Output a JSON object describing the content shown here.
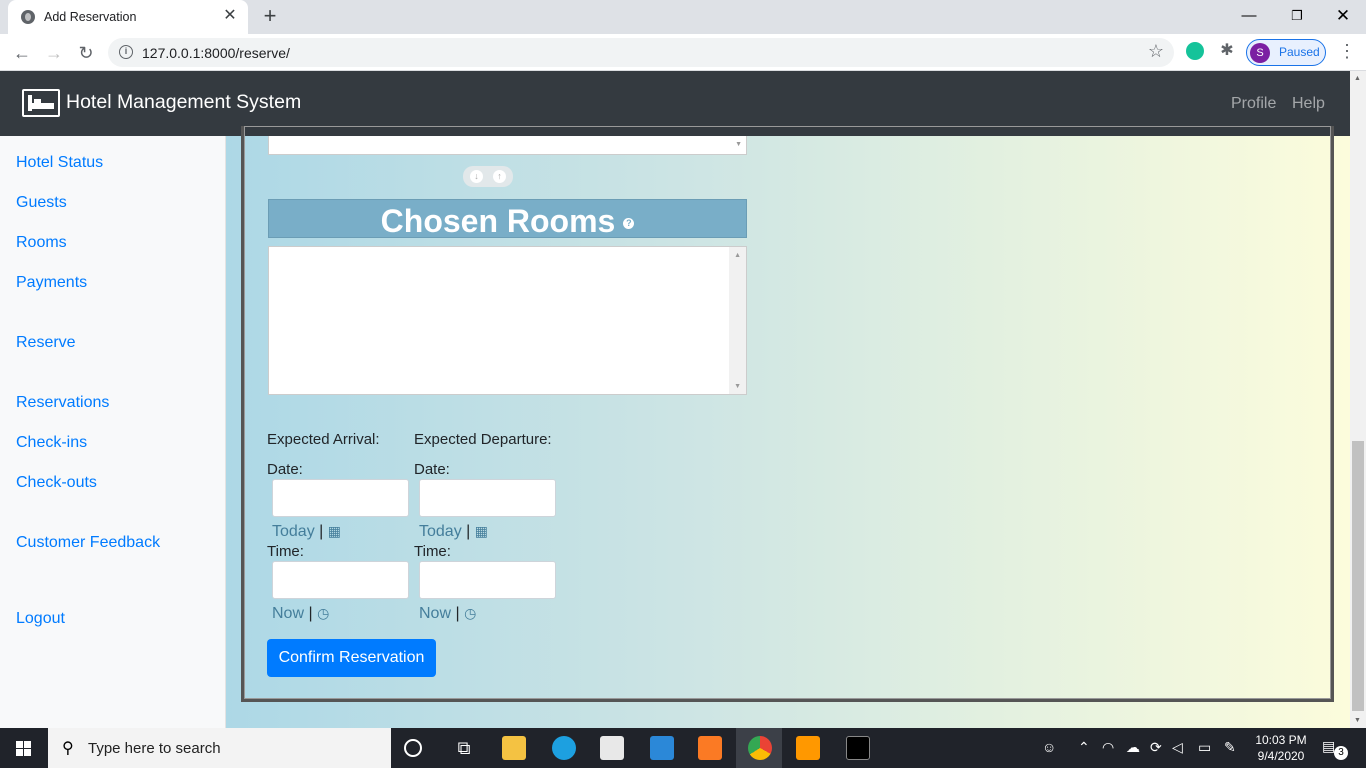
{
  "browser": {
    "tab_title": "Add Reservation",
    "url": "127.0.0.1:8000/reserve/",
    "profile_letter": "S",
    "profile_status": "Paused"
  },
  "app": {
    "brand": "Hotel Management System",
    "nav": [
      "Profile",
      "Help"
    ]
  },
  "sidebar": {
    "items": [
      {
        "label": "Hotel Status"
      },
      {
        "label": "Guests"
      },
      {
        "label": "Rooms"
      },
      {
        "label": "Payments"
      },
      {
        "label": "Reserve"
      },
      {
        "label": "Reservations"
      },
      {
        "label": "Check-ins"
      },
      {
        "label": "Check-outs"
      },
      {
        "label": "Customer Feedback"
      },
      {
        "label": "Logout"
      }
    ]
  },
  "form": {
    "chosen_rooms_title": "Chosen Rooms",
    "arrival": {
      "heading": "Expected Arrival:",
      "date_label": "Date:",
      "date_value": "",
      "today_link": "Today",
      "time_label": "Time:",
      "time_value": "",
      "now_link": "Now"
    },
    "departure": {
      "heading": "Expected Departure:",
      "date_label": "Date:",
      "date_value": "",
      "today_link": "Today",
      "time_label": "Time:",
      "time_value": "",
      "now_link": "Now"
    },
    "separator": "|",
    "confirm_label": "Confirm Reservation"
  },
  "taskbar": {
    "search_placeholder": "Type here to search",
    "time": "10:03 PM",
    "date": "9/4/2020",
    "notification_count": "3"
  },
  "colors": {
    "accent": "#007bff",
    "navbar": "#343a40",
    "admin_header": "#79aec8",
    "link_dark": "#447e9b"
  }
}
